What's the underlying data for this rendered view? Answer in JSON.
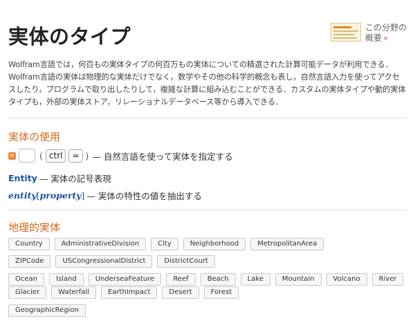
{
  "page": {
    "title": "実体のタイプ",
    "overview": {
      "label": "この分野の概要",
      "arrow": "»"
    },
    "intro": "Wolfram言語では，何百もの実体タイプの何百万もの実体についての精選された計算可能データが利用できる．Wolfram言語の実体は物理的な実体だけでなく，数学やその他の科学的概念も表し，自然言語入力を使ってアクセスしたり，プログラムで取り出したりして，複雑な計算に組み込むことができる．カスタムの実体タイプや動的実体タイプも，外部の実体ストア，リレーショナルデータベース等から導入できる．"
  },
  "usage": {
    "title": "実体の使用",
    "nl_input": {
      "open_paren": "(",
      "key1": "ctrl",
      "key2": "=",
      "close_paren": ")",
      "description": "— 自然言語を使って実体を指定する"
    },
    "entity_line": {
      "symbol": "Entity",
      "description": "— 実体の記号表現"
    },
    "property_line": {
      "entity": "entity",
      "open": "[",
      "property": "property",
      "close": "]",
      "description": "— 実体の特性の値を抽出する"
    }
  },
  "geo": {
    "title": "地理的実体",
    "rows": [
      [
        "Country",
        "AdministrativeDivision",
        "City",
        "Neighborhood",
        "MetropolitanArea"
      ],
      [
        "ZIPCode",
        "USCongressionalDistrict",
        "DistrictCourt"
      ],
      [
        "Ocean",
        "Island",
        "UnderseaFeature",
        "Reef",
        "Beach",
        "Lake",
        "Mountain",
        "Volcano",
        "River"
      ],
      [
        "Glacier",
        "Waterfall",
        "EarthImpact",
        "Desert",
        "Forest"
      ],
      [
        "GeographicRegion"
      ]
    ]
  }
}
